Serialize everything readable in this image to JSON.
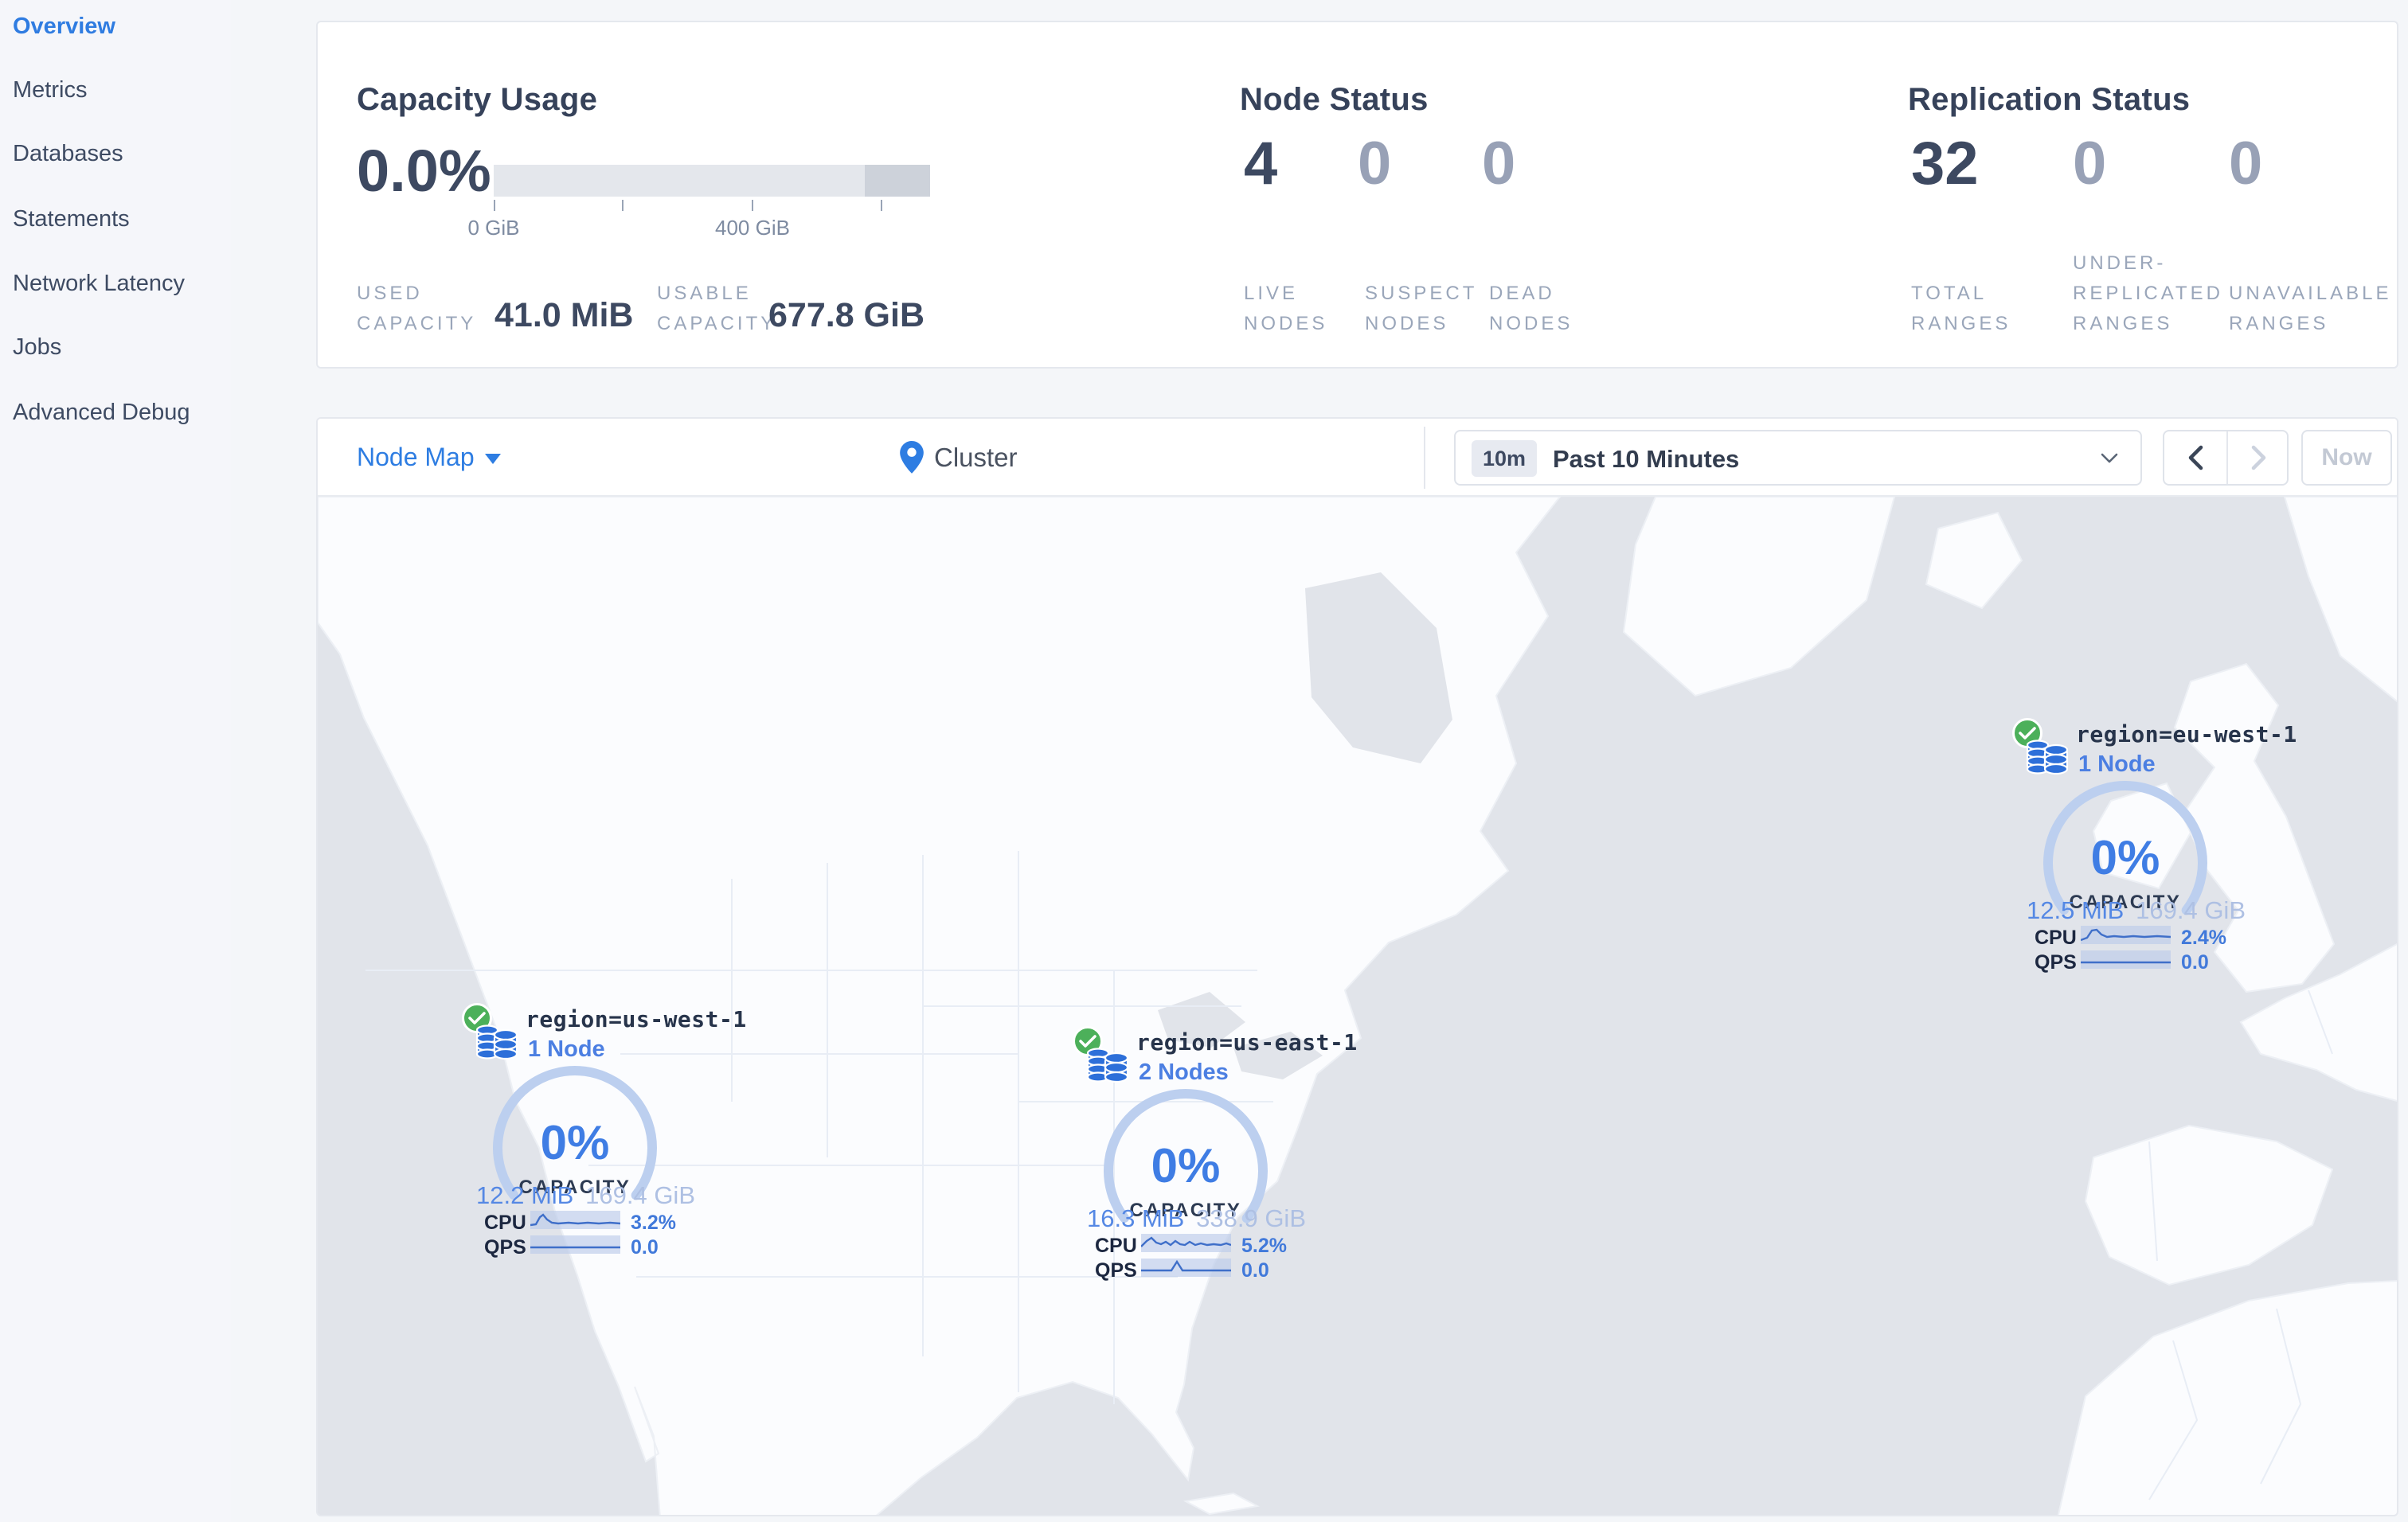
{
  "colors": {
    "accent_blue": "#2f7ce1",
    "dark_text": "#3d4961",
    "muted_label": "#9aa6ba",
    "dim_value": "#98a1b6",
    "green_ok": "#4cb05a",
    "gauge_track": "#bccfef",
    "ocean": "#e1e4ea",
    "land": "#fbfcfe"
  },
  "icons": {
    "view_caret": "caret-down-icon",
    "breadcrumb_pin": "map-pin-icon",
    "time_dropdown": "chevron-down-icon",
    "prev": "chevron-left-icon",
    "next": "chevron-right-icon",
    "region_ok": "check-circle-icon",
    "region_db": "database-stack-icon"
  },
  "sidebar": {
    "items": [
      {
        "label": "Overview",
        "active": true
      },
      {
        "label": "Metrics",
        "active": false
      },
      {
        "label": "Databases",
        "active": false
      },
      {
        "label": "Statements",
        "active": false
      },
      {
        "label": "Network Latency",
        "active": false
      },
      {
        "label": "Jobs",
        "active": false
      },
      {
        "label": "Advanced Debug",
        "active": false
      }
    ]
  },
  "capacity_panel": {
    "title": "Capacity Usage",
    "percent": "0.0%",
    "ticks": [
      "0 GiB",
      "400 GiB"
    ],
    "used": {
      "l1": "USED",
      "l2": "CAPACITY",
      "value": "41.0 MiB"
    },
    "usable": {
      "l1": "USABLE",
      "l2": "CAPACITY",
      "value": "677.8 GiB"
    }
  },
  "node_panel": {
    "title": "Node Status",
    "live": {
      "value": "4",
      "l1": "LIVE",
      "l2": "NODES"
    },
    "suspect": {
      "value": "0",
      "l1": "SUSPECT",
      "l2": "NODES"
    },
    "dead": {
      "value": "0",
      "l1": "DEAD",
      "l2": "NODES"
    }
  },
  "replication_panel": {
    "title": "Replication Status",
    "total": {
      "value": "32",
      "l1": "TOTAL",
      "l2": "RANGES"
    },
    "under": {
      "value": "0",
      "l1": "UNDER-",
      "l2": "REPLICATED",
      "l3": "RANGES"
    },
    "unavailable": {
      "value": "0",
      "l1": "UNAVAILABLE",
      "l2": "RANGES"
    }
  },
  "toolbar": {
    "view": "Node Map",
    "breadcrumb": "Cluster",
    "time_badge": "10m",
    "time_range": "Past 10 Minutes",
    "now": "Now"
  },
  "map": {
    "regions": [
      {
        "name": "region=us-west-1",
        "nodes": "1 Node",
        "percent": "0%",
        "capacity_label": "CAPACITY",
        "used": "12.2 MiB",
        "total": "169.4 GiB",
        "cpu_label": "CPU",
        "cpu": "3.2%",
        "qps_label": "QPS",
        "qps": "0.0",
        "cpu_spark": [
          0,
          20,
          7,
          19,
          12,
          10,
          16,
          7,
          21,
          13,
          27,
          17,
          35,
          18,
          48,
          17,
          60,
          18,
          72,
          17,
          86,
          18,
          100,
          17,
          113,
          18
        ],
        "qps_spark": [
          0,
          17,
          113,
          17
        ]
      },
      {
        "name": "region=us-east-1",
        "nodes": "2 Nodes",
        "percent": "0%",
        "capacity_label": "CAPACITY",
        "used": "16.3 MiB",
        "total": "338.9 GiB",
        "cpu_label": "CPU",
        "cpu": "5.2%",
        "qps_label": "QPS",
        "qps": "0.0",
        "cpu_spark": [
          0,
          18,
          7,
          11,
          13,
          7,
          19,
          13,
          25,
          15,
          31,
          12,
          37,
          16,
          43,
          11,
          49,
          15,
          55,
          16,
          61,
          12,
          68,
          16,
          75,
          14,
          83,
          16,
          91,
          15,
          100,
          16,
          107,
          14,
          113,
          16
        ],
        "qps_spark": [
          0,
          17,
          38,
          17,
          45,
          6,
          52,
          17,
          113,
          17
        ]
      },
      {
        "name": "region=eu-west-1",
        "nodes": "1 Node",
        "percent": "0%",
        "capacity_label": "CAPACITY",
        "used": "12.5 MiB",
        "total": "169.4 GiB",
        "cpu_label": "CPU",
        "cpu": "2.4%",
        "qps_label": "QPS",
        "qps": "0.0",
        "cpu_spark": [
          0,
          20,
          8,
          17,
          14,
          8,
          20,
          7,
          26,
          13,
          33,
          16,
          42,
          15,
          54,
          16,
          66,
          15,
          80,
          16,
          96,
          15,
          113,
          16
        ],
        "qps_spark": [
          0,
          17,
          113,
          17
        ]
      }
    ]
  }
}
